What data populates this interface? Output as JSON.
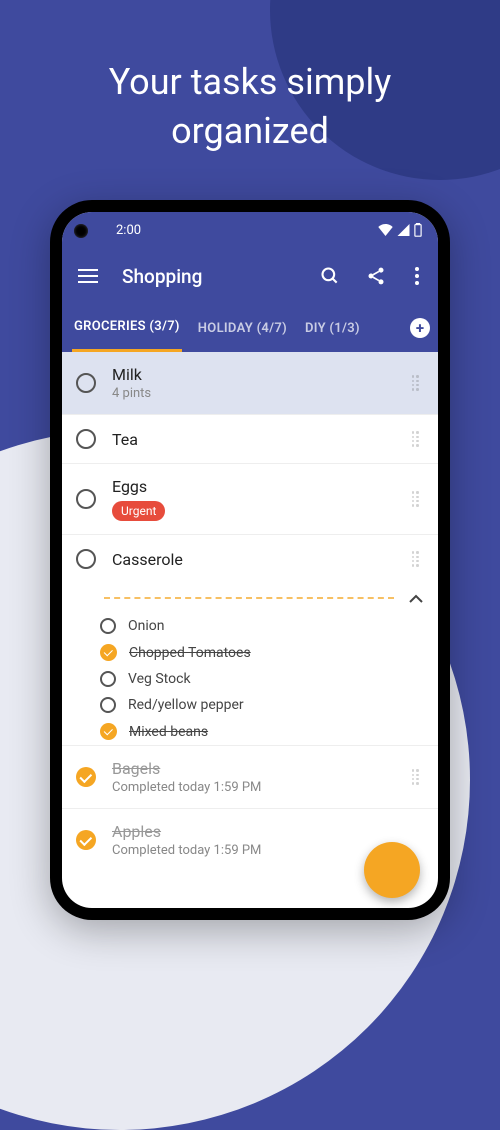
{
  "headline_l1": "Your tasks simply",
  "headline_l2": "organized",
  "status": {
    "time": "2:00"
  },
  "header": {
    "title": "Shopping"
  },
  "tabs": [
    {
      "label": "GROCERIES (3/7)"
    },
    {
      "label": "HOLIDAY (4/7)"
    },
    {
      "label": "DIY (1/3)"
    }
  ],
  "items": {
    "milk": {
      "title": "Milk",
      "sub": "4 pints"
    },
    "tea": {
      "title": "Tea"
    },
    "eggs": {
      "title": "Eggs",
      "chip": "Urgent"
    },
    "casserole": {
      "title": "Casserole"
    },
    "sub_onion": {
      "title": "Onion"
    },
    "sub_tomatoes": {
      "title": "Chopped Tomatoes"
    },
    "sub_vegstock": {
      "title": "Veg Stock"
    },
    "sub_pepper": {
      "title": "Red/yellow pepper"
    },
    "sub_beans": {
      "title": "Mixed beans"
    },
    "bagels": {
      "title": "Bagels",
      "sub": "Completed today 1:59 PM"
    },
    "apples": {
      "title": "Apples",
      "sub": "Completed today 1:59 PM"
    }
  }
}
